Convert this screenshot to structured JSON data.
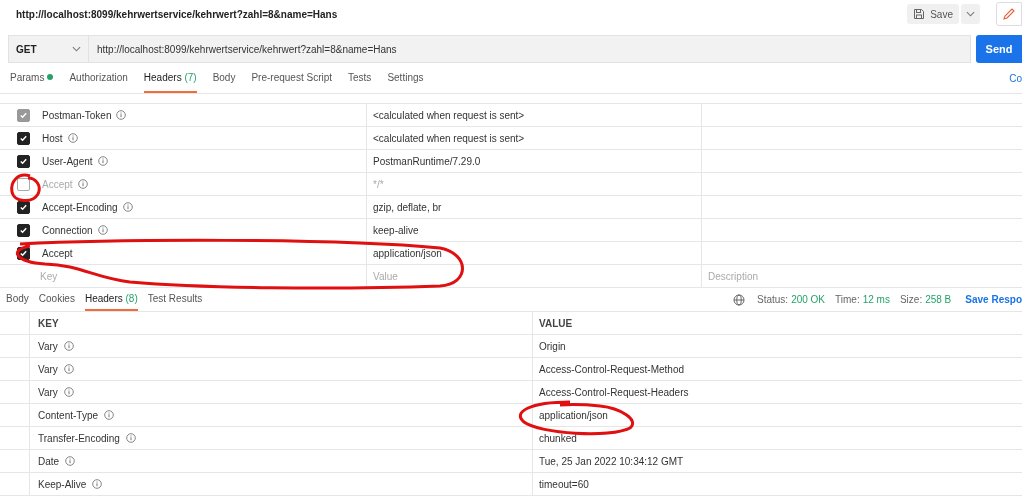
{
  "title_url": "http://localhost:8099/kehrwertservice/kehrwert?zahl=8&name=Hans",
  "save_button": {
    "label": "Save"
  },
  "request": {
    "method": "GET",
    "url": "http://localhost:8099/kehrwertservice/kehrwert?zahl=8&name=Hans",
    "send": "Send"
  },
  "request_tabs": [
    {
      "label": "Params",
      "dot": true,
      "selected": false
    },
    {
      "label": "Authorization",
      "dot": false,
      "selected": false
    },
    {
      "label": "Headers",
      "count": "(7)",
      "dot": false,
      "selected": true
    },
    {
      "label": "Body",
      "dot": false,
      "selected": false
    },
    {
      "label": "Pre-request Script",
      "dot": false,
      "selected": false
    },
    {
      "label": "Tests",
      "dot": false,
      "selected": false
    },
    {
      "label": "Settings",
      "dot": false,
      "selected": false
    }
  ],
  "cookies_link": "Co",
  "request_headers": [
    {
      "key": "Postman-Token",
      "value": "<calculated when request is sent>",
      "checked": true,
      "disabled": true,
      "info": true
    },
    {
      "key": "Host",
      "value": "<calculated when request is sent>",
      "checked": true,
      "disabled": false,
      "info": true
    },
    {
      "key": "User-Agent",
      "value": "PostmanRuntime/7.29.0",
      "checked": true,
      "disabled": false,
      "info": true
    },
    {
      "key": "Accept",
      "value": "*/*",
      "checked": false,
      "disabled": false,
      "info": true
    },
    {
      "key": "Accept-Encoding",
      "value": "gzip, deflate, br",
      "checked": true,
      "disabled": false,
      "info": true
    },
    {
      "key": "Connection",
      "value": "keep-alive",
      "checked": true,
      "disabled": false,
      "info": true
    },
    {
      "key": "Accept",
      "value": "application/json",
      "checked": true,
      "disabled": false,
      "info": false
    }
  ],
  "new_header": {
    "key_placeholder": "Key",
    "value_placeholder": "Value",
    "description_placeholder": "Description"
  },
  "response_tabs": [
    {
      "label": "Body",
      "selected": false
    },
    {
      "label": "Cookies",
      "selected": false
    },
    {
      "label": "Headers",
      "count": "(8)",
      "selected": true
    },
    {
      "label": "Test Results",
      "selected": false
    }
  ],
  "response_status": [
    {
      "label": "Status:",
      "value": "200 OK"
    },
    {
      "label": "Time:",
      "value": "12 ms"
    },
    {
      "label": "Size:",
      "value": "258 B"
    }
  ],
  "save_response": "Save Respo",
  "response_columns": [
    "KEY",
    "VALUE"
  ],
  "response_headers": [
    {
      "key": "Vary",
      "value": "Origin"
    },
    {
      "key": "Vary",
      "value": "Access-Control-Request-Method"
    },
    {
      "key": "Vary",
      "value": "Access-Control-Request-Headers"
    },
    {
      "key": "Content-Type",
      "value": "application/json"
    },
    {
      "key": "Transfer-Encoding",
      "value": "chunked"
    },
    {
      "key": "Date",
      "value": "Tue, 25 Jan 2022 10:34:12 GMT"
    },
    {
      "key": "Keep-Alive",
      "value": "timeout=60"
    }
  ]
}
